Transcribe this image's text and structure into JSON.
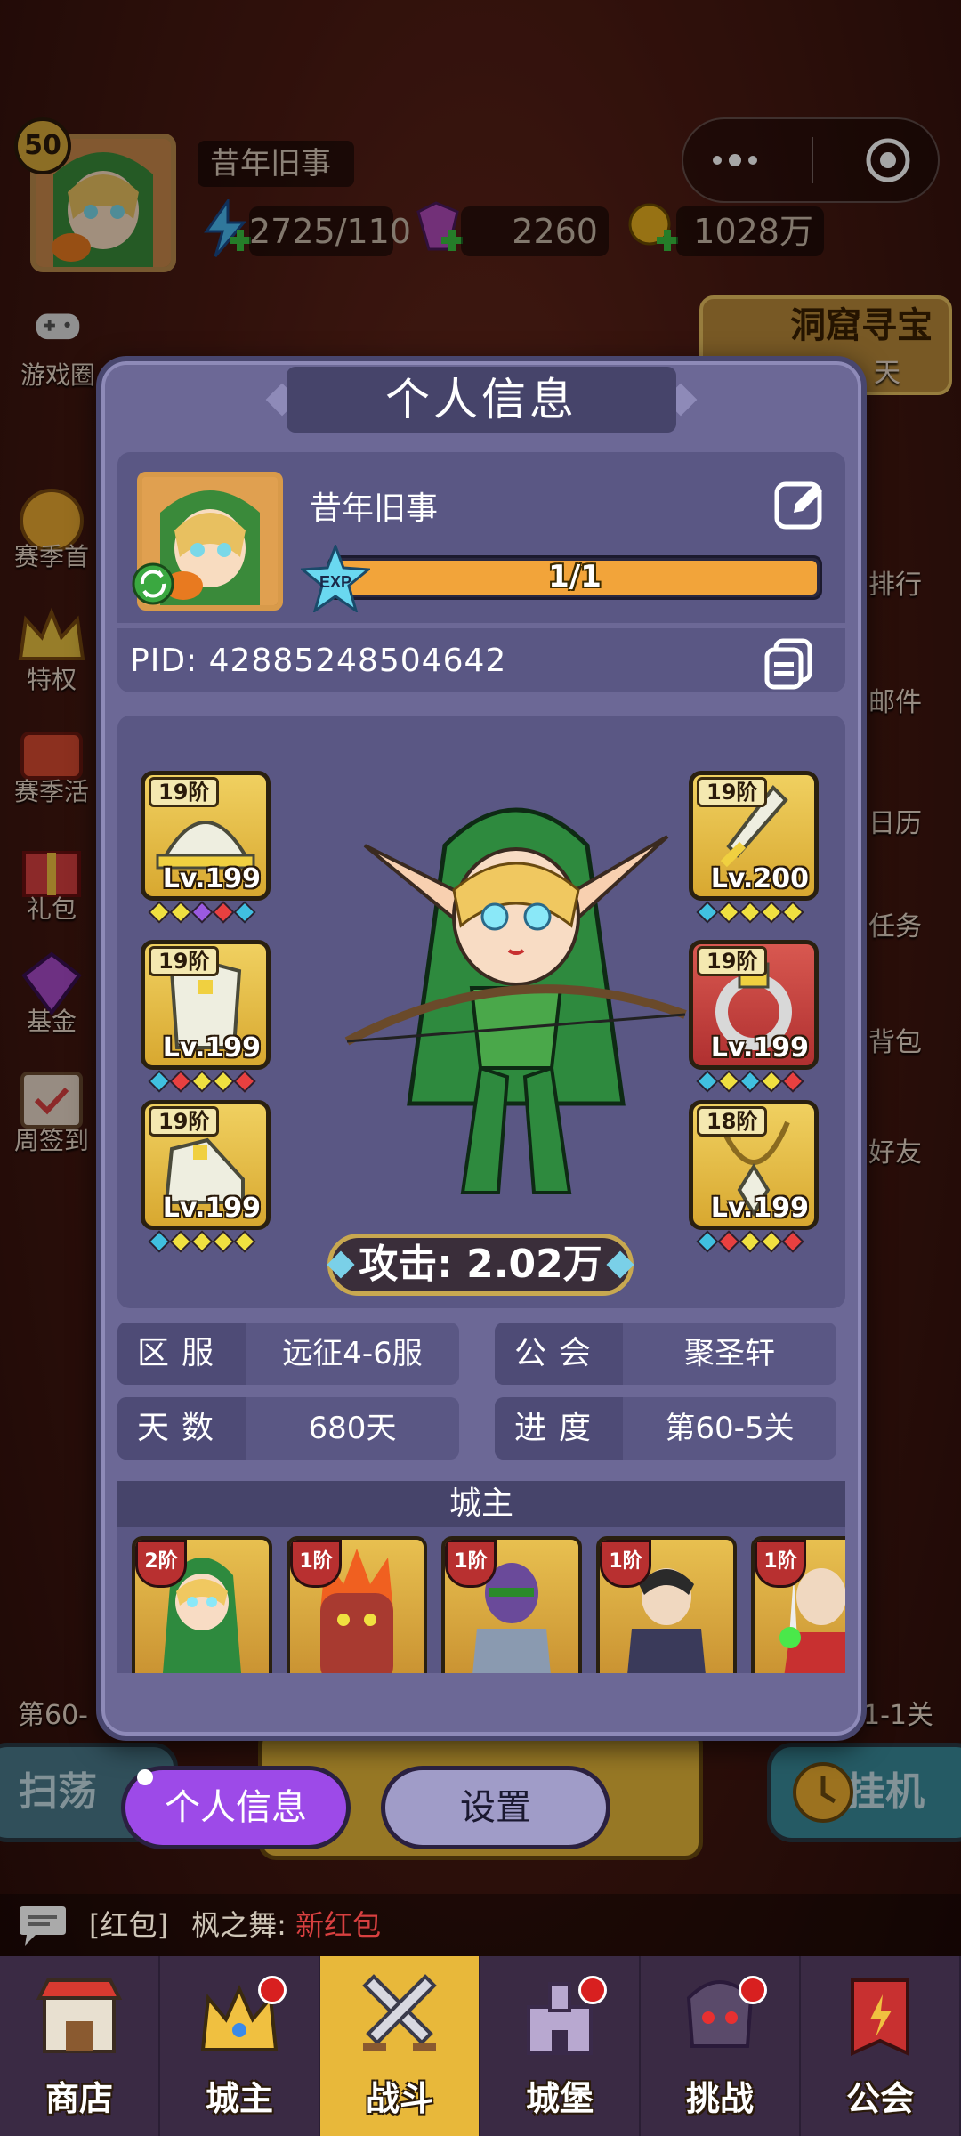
{
  "header": {
    "level": "50",
    "player_name": "昔年旧事",
    "energy": "2725/110",
    "gems": "2260",
    "gold": "1028万",
    "cave_event": "洞窟寻宝",
    "cave_event_sub": "天"
  },
  "left_menu": [
    {
      "label": "游戏圈"
    },
    {
      "label": "赛季首"
    },
    {
      "label": "特权"
    },
    {
      "label": "赛季活"
    },
    {
      "label": "礼包"
    },
    {
      "label": "基金"
    },
    {
      "label": "周签到"
    }
  ],
  "right_menu": [
    {
      "label": "排行"
    },
    {
      "label": "邮件"
    },
    {
      "label": "日历"
    },
    {
      "label": "任务"
    },
    {
      "label": "背包"
    },
    {
      "label": "好友"
    }
  ],
  "stage_left": "第60-",
  "stage_right": "1-1关",
  "modal": {
    "title": "个人信息",
    "name": "昔年旧事",
    "exp_label": "EXP",
    "exp_text": "1/1",
    "exp_fill": 1.0,
    "pid": "PID:  42885248504642",
    "left_equip": [
      {
        "rank": "19阶",
        "lv": "Lv.199",
        "gems": [
          "#f0e040",
          "#f0e040",
          "#9a5ae0",
          "#e84040",
          "#40c0e0"
        ]
      },
      {
        "rank": "19阶",
        "lv": "Lv.199",
        "gems": [
          "#40c0e0",
          "#e84040",
          "#f0e040",
          "#f0e040",
          "#e84040"
        ]
      },
      {
        "rank": "19阶",
        "lv": "Lv.199",
        "gems": [
          "#40c0e0",
          "#f0e040",
          "#f0e040",
          "#f0e040",
          "#f0e040"
        ]
      }
    ],
    "right_equip": [
      {
        "rank": "19阶",
        "lv": "Lv.200",
        "gems": [
          "#40c0e0",
          "#f0e040",
          "#f0e040",
          "#f0e040",
          "#f0e040"
        ]
      },
      {
        "rank": "19阶",
        "lv": "Lv.199",
        "gems": [
          "#40c0e0",
          "#f0e040",
          "#40c0e0",
          "#f0e040",
          "#e84040"
        ]
      },
      {
        "rank": "18阶",
        "lv": "Lv.199",
        "gems": [
          "#40c0e0",
          "#e84040",
          "#f0e040",
          "#f0e040",
          "#e84040"
        ]
      }
    ],
    "attack": "攻击:  2.02万",
    "info": {
      "server_label": "区服",
      "server_value": "远征4-6服",
      "guild_label": "公会",
      "guild_value": "聚圣轩",
      "days_label": "天数",
      "days_value": "680天",
      "progress_label": "进度",
      "progress_value": "第60-5关"
    },
    "lord_title": "城主",
    "lords": [
      {
        "rank": "2阶"
      },
      {
        "rank": "1阶"
      },
      {
        "rank": "1阶"
      },
      {
        "rank": "1阶"
      },
      {
        "rank": "1阶"
      }
    ],
    "btn_info": "个人信息",
    "btn_settings": "设置"
  },
  "bottom_bg_left": "扫荡",
  "bottom_bg_right": "挂机",
  "chat": {
    "tag": "[红包]",
    "sender": "枫之舞:",
    "message": "新红包"
  },
  "nav": [
    {
      "label": "商店",
      "dot": false
    },
    {
      "label": "城主",
      "dot": true
    },
    {
      "label": "战斗",
      "dot": false
    },
    {
      "label": "城堡",
      "dot": true
    },
    {
      "label": "挑战",
      "dot": true
    },
    {
      "label": "公会",
      "dot": false
    }
  ]
}
